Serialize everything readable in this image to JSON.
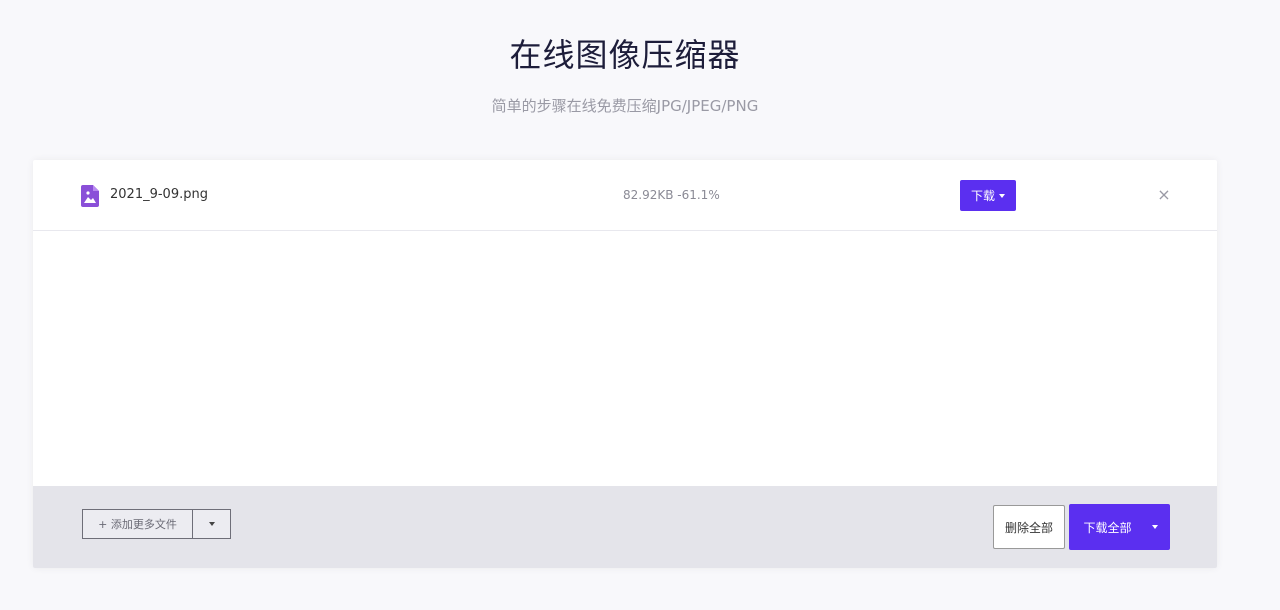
{
  "header": {
    "title": "在线图像压缩器",
    "subtitle": "简单的步骤在线免费压缩JPG/JPEG/PNG"
  },
  "file": {
    "name": "2021_9-09.png",
    "stats": "82.92KB -61.1%",
    "download_label": "下载",
    "icon": "image-file-icon"
  },
  "footer": {
    "add_more_label": "+ 添加更多文件",
    "delete_all_label": "删除全部",
    "download_all_label": "下载全部"
  },
  "colors": {
    "accent": "#5b2ff0",
    "footer_bg": "#e4e4ea",
    "icon": "#8a4fd8"
  }
}
